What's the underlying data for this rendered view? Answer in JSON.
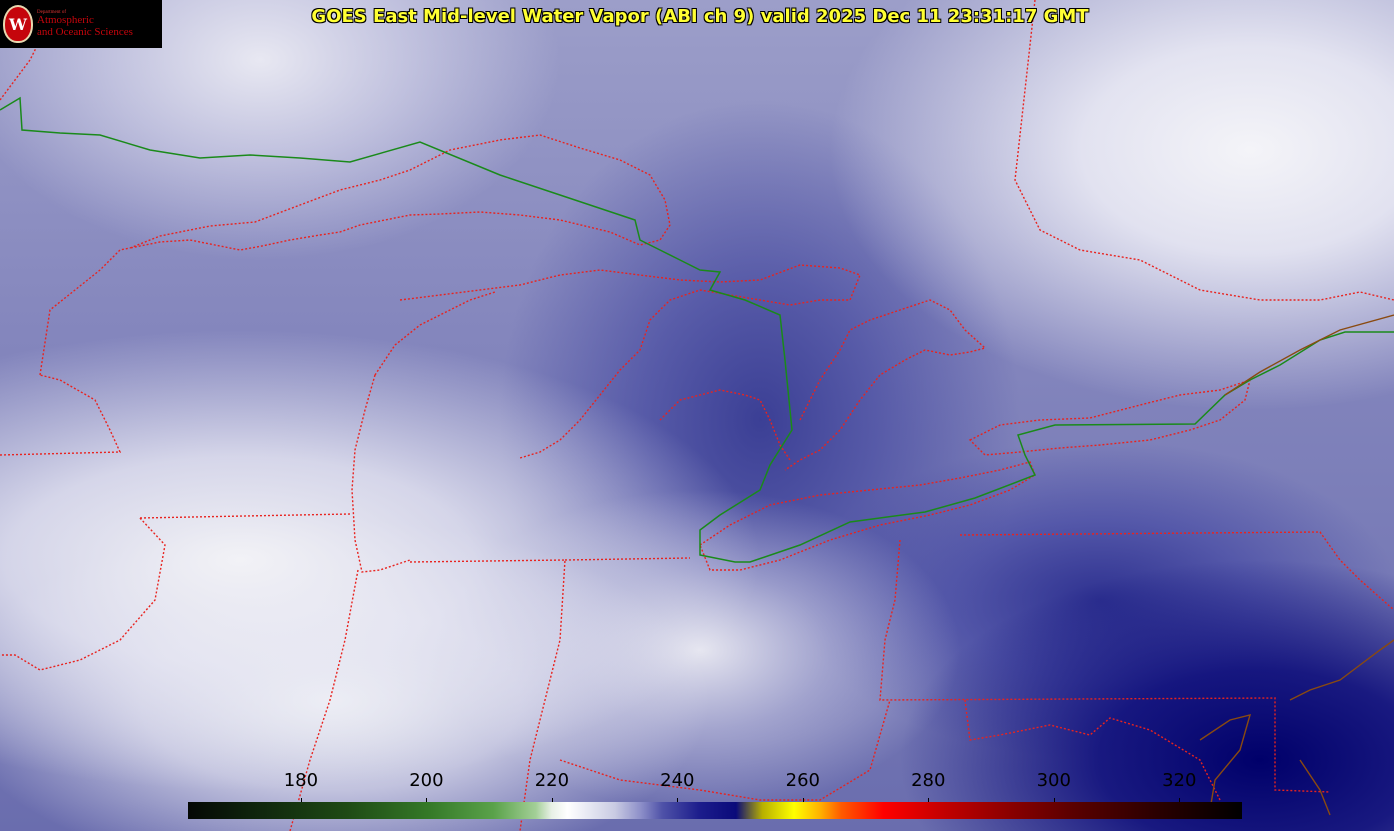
{
  "title": "GOES East Mid-level Water Vapor (ABI ch 9)  valid 2025 Dec 11 23:31:17 GMT",
  "logo": {
    "dept": "Department of",
    "line1": "Atmospheric",
    "line2": "and Oceanic Sciences",
    "seal_letter": "W"
  },
  "colorbar": {
    "ticks": [
      "180",
      "200",
      "220",
      "240",
      "260",
      "280",
      "300",
      "320"
    ],
    "tick_values": [
      180,
      200,
      220,
      240,
      260,
      280,
      300,
      320
    ],
    "range": [
      162,
      330
    ]
  },
  "colors": {
    "title": "#ffff33",
    "state_borders": "#e8231f",
    "intl_border": "#1a8a1a",
    "coastline": "#8a4a10"
  },
  "icons": [
    "uw-seal-icon"
  ]
}
